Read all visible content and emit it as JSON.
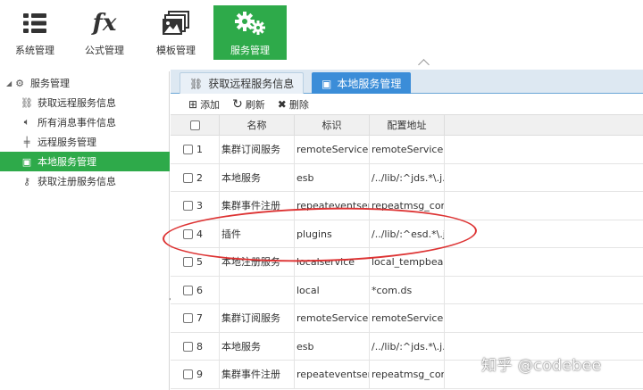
{
  "toolbar": {
    "items": [
      {
        "label": "系统管理",
        "icon": "list-icon"
      },
      {
        "label": "公式管理",
        "icon": "fx-icon",
        "glyph": "fx"
      },
      {
        "label": "模板管理",
        "icon": "image-stack-icon"
      },
      {
        "label": "服务管理",
        "icon": "gears-icon",
        "active": true
      }
    ]
  },
  "tree": {
    "root": "服务管理",
    "items": [
      {
        "label": "获取远程服务信息",
        "icon": "link-icon"
      },
      {
        "label": "所有消息事件信息",
        "icon": "speaker-icon"
      },
      {
        "label": "远程服务管理",
        "icon": "plug-icon"
      },
      {
        "label": "本地服务管理",
        "icon": "terminal-icon",
        "selected": true
      },
      {
        "label": "获取注册服务信息",
        "icon": "key-icon"
      }
    ]
  },
  "tabs": [
    {
      "label": "获取远程服务信息",
      "icon": "link-icon"
    },
    {
      "label": "本地服务管理",
      "icon": "terminal-icon",
      "active": true
    }
  ],
  "actions": {
    "add": "添加",
    "refresh": "刷新",
    "delete": "删除"
  },
  "grid": {
    "columns": [
      "名称",
      "标识",
      "配置地址"
    ],
    "rows": [
      {
        "num": "1",
        "name": "集群订阅服务",
        "id": "remoteService",
        "config": "remoteService"
      },
      {
        "num": "2",
        "name": "本地服务",
        "id": "esb",
        "config": "/../lib/:^jds.*\\.j..."
      },
      {
        "num": "3",
        "name": "集群事件注册",
        "id": "repeateventserv...",
        "config": "repeatmsg_conf..."
      },
      {
        "num": "4",
        "name": "插件",
        "id": "plugins",
        "config": "/../lib/:^esd.*\\.j..."
      },
      {
        "num": "5",
        "name": "本地注册服务",
        "id": "localservice",
        "config": "local_tempbean..."
      },
      {
        "num": "6",
        "name": "",
        "id": "local",
        "config": "*com.ds"
      },
      {
        "num": "7",
        "name": "集群订阅服务",
        "id": "remoteService",
        "config": "remoteService"
      },
      {
        "num": "8",
        "name": "本地服务",
        "id": "esb",
        "config": "/../lib/:^jds.*\\.j..."
      },
      {
        "num": "9",
        "name": "集群事件注册",
        "id": "repeateventserv...",
        "config": "repeatmsg_conf..."
      }
    ]
  },
  "watermark": "知乎 @codebee",
  "colors": {
    "accent_green": "#2eaa4a",
    "tab_blue": "#3b8dd8",
    "annotation_red": "#dd3333"
  }
}
